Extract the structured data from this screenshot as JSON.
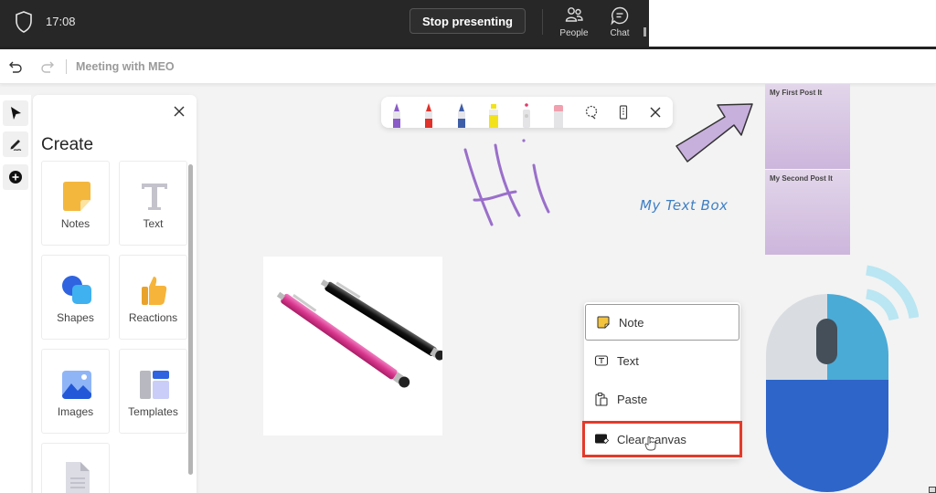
{
  "topbar": {
    "time": "17:08",
    "stop_presenting_label": "Stop presenting",
    "people_label": "People",
    "chat_label": "Chat"
  },
  "titlebar": {
    "title": "Meeting with MEO"
  },
  "rail": {
    "items": [
      "select-tool",
      "pen-tool",
      "add-tool"
    ]
  },
  "create_panel": {
    "heading": "Create",
    "tiles": [
      {
        "label": "Notes",
        "icon": "sticky-note-icon"
      },
      {
        "label": "Text",
        "icon": "text-icon"
      },
      {
        "label": "Shapes",
        "icon": "shapes-icon"
      },
      {
        "label": "Reactions",
        "icon": "thumbs-up-icon"
      },
      {
        "label": "Images",
        "icon": "image-icon"
      },
      {
        "label": "Templates",
        "icon": "templates-icon"
      },
      {
        "label": "",
        "icon": "document-icon"
      }
    ]
  },
  "ink_toolbar": {
    "pens": [
      {
        "name": "purple-pen",
        "color": "#8a5cc8"
      },
      {
        "name": "red-pen",
        "color": "#e0312a"
      },
      {
        "name": "blue-pen",
        "color": "#3f5ea8"
      },
      {
        "name": "yellow-highlighter",
        "color": "#f2e21a"
      },
      {
        "name": "laser-pointer",
        "color": "#e23a6a"
      },
      {
        "name": "eraser",
        "color": "#f0a0ae"
      }
    ],
    "tools": [
      "lasso-icon",
      "ruler-icon",
      "close-icon"
    ]
  },
  "canvas": {
    "handwriting": "Hi",
    "text_box": "My Text Box",
    "post_its": [
      "My First Post It",
      "My Second Post It"
    ],
    "ink_color": "#9a6fcb",
    "arrow_color": "#c8b0dd"
  },
  "context_menu": {
    "items": [
      {
        "label": "Note",
        "icon": "note-icon"
      },
      {
        "label": "Text",
        "icon": "text-box-icon"
      },
      {
        "label": "Paste",
        "icon": "paste-icon"
      },
      {
        "label": "Clear canvas",
        "icon": "clear-canvas-icon",
        "highlighted": true
      }
    ],
    "highlight_color": "#e43a2a"
  }
}
